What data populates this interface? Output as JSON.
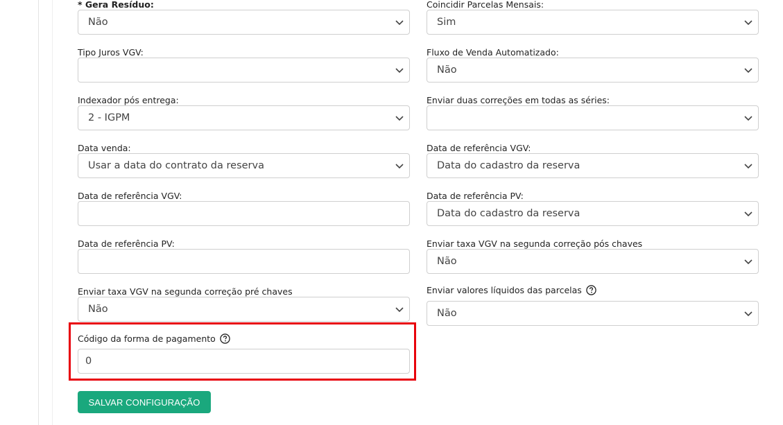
{
  "fields": {
    "gera_residuo": {
      "label_required": "* Gera Resíduo:",
      "value": "Não"
    },
    "coincidir_parcelas": {
      "label": "Coincidir Parcelas Mensais:",
      "value": "Sim"
    },
    "tipo_juros_vgv": {
      "label": "Tipo Juros VGV:",
      "value": ""
    },
    "fluxo_venda_auto": {
      "label": "Fluxo de Venda Automatizado:",
      "value": "Não"
    },
    "indexador_pos_entrega": {
      "label": "Indexador pós entrega:",
      "value": "2 - IGPM"
    },
    "enviar_duas_correcoes": {
      "label": "Enviar duas correções em todas as séries:",
      "value": ""
    },
    "data_venda": {
      "label": "Data venda:",
      "value": "Usar a data do contrato da reserva"
    },
    "data_ref_vgv_select": {
      "label": "Data de referência VGV:",
      "value": "Data do cadastro da reserva"
    },
    "data_ref_vgv_input": {
      "label": "Data de referência VGV:",
      "value": ""
    },
    "data_ref_pv_select": {
      "label": "Data de referência PV:",
      "value": "Data do cadastro da reserva"
    },
    "data_ref_pv_input": {
      "label": "Data de referência PV:",
      "value": ""
    },
    "taxa_vgv_pos_chaves": {
      "label": "Enviar taxa VGV na segunda correção pós chaves",
      "value": "Não"
    },
    "taxa_vgv_pre_chaves": {
      "label": "Enviar taxa VGV na segunda correção pré chaves",
      "value": "Não"
    },
    "valores_liquidos": {
      "label": "Enviar valores líquidos das parcelas",
      "value": "Não"
    },
    "codigo_forma_pagamento": {
      "label": "Código da forma de pagamento",
      "value": "0"
    }
  },
  "actions": {
    "save_label": "SALVAR CONFIGURAÇÃO"
  },
  "colors": {
    "accent": "#1aa87d",
    "highlight": "#e8000b"
  }
}
